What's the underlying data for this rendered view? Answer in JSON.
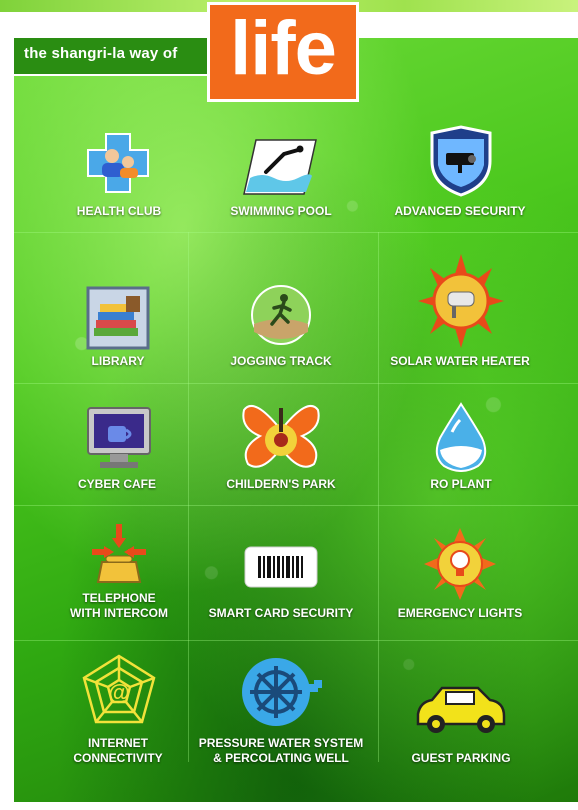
{
  "header": {
    "tagline": "the shangri-la way of",
    "headline": "life"
  },
  "amenities": [
    {
      "label_line1": "HEALTH CLUB",
      "label_line2": "",
      "icon": "health-club-icon"
    },
    {
      "label_line1": "SWIMMING POOL",
      "label_line2": "",
      "icon": "swimming-pool-icon"
    },
    {
      "label_line1": "ADVANCED SECURITY",
      "label_line2": "",
      "icon": "security-camera-icon"
    },
    {
      "label_line1": "LIBRARY",
      "label_line2": "",
      "icon": "library-books-icon"
    },
    {
      "label_line1": "JOGGING TRACK",
      "label_line2": "",
      "icon": "jogging-runner-icon"
    },
    {
      "label_line1": "SOLAR WATER HEATER",
      "label_line2": "",
      "icon": "solar-sun-icon"
    },
    {
      "label_line1": "CYBER CAFE",
      "label_line2": "",
      "icon": "computer-cup-icon"
    },
    {
      "label_line1": "CHILDERN'S PARK",
      "label_line2": "",
      "icon": "butterfly-flower-icon"
    },
    {
      "label_line1": "RO PLANT",
      "label_line2": "",
      "icon": "water-drop-icon"
    },
    {
      "label_line1": "TELEPHONE",
      "label_line2": "WITH INTERCOM",
      "icon": "telephone-icon"
    },
    {
      "label_line1": "SMART CARD SECURITY",
      "label_line2": "",
      "icon": "barcode-card-icon"
    },
    {
      "label_line1": "EMERGENCY LIGHTS",
      "label_line2": "",
      "icon": "emergency-bulb-icon"
    },
    {
      "label_line1": "INTERNET",
      "label_line2": "CONNECTIVITY",
      "icon": "web-at-icon"
    },
    {
      "label_line1": "PRESSURE WATER SYSTEM",
      "label_line2": "& PERCOLATING WELL",
      "icon": "water-wheel-icon"
    },
    {
      "label_line1": "GUEST PARKING",
      "label_line2": "",
      "icon": "car-icon"
    }
  ],
  "colors": {
    "brand_orange": "#f26a1b",
    "leaf_green": "#4cc81e",
    "label_white": "#ffffff"
  }
}
